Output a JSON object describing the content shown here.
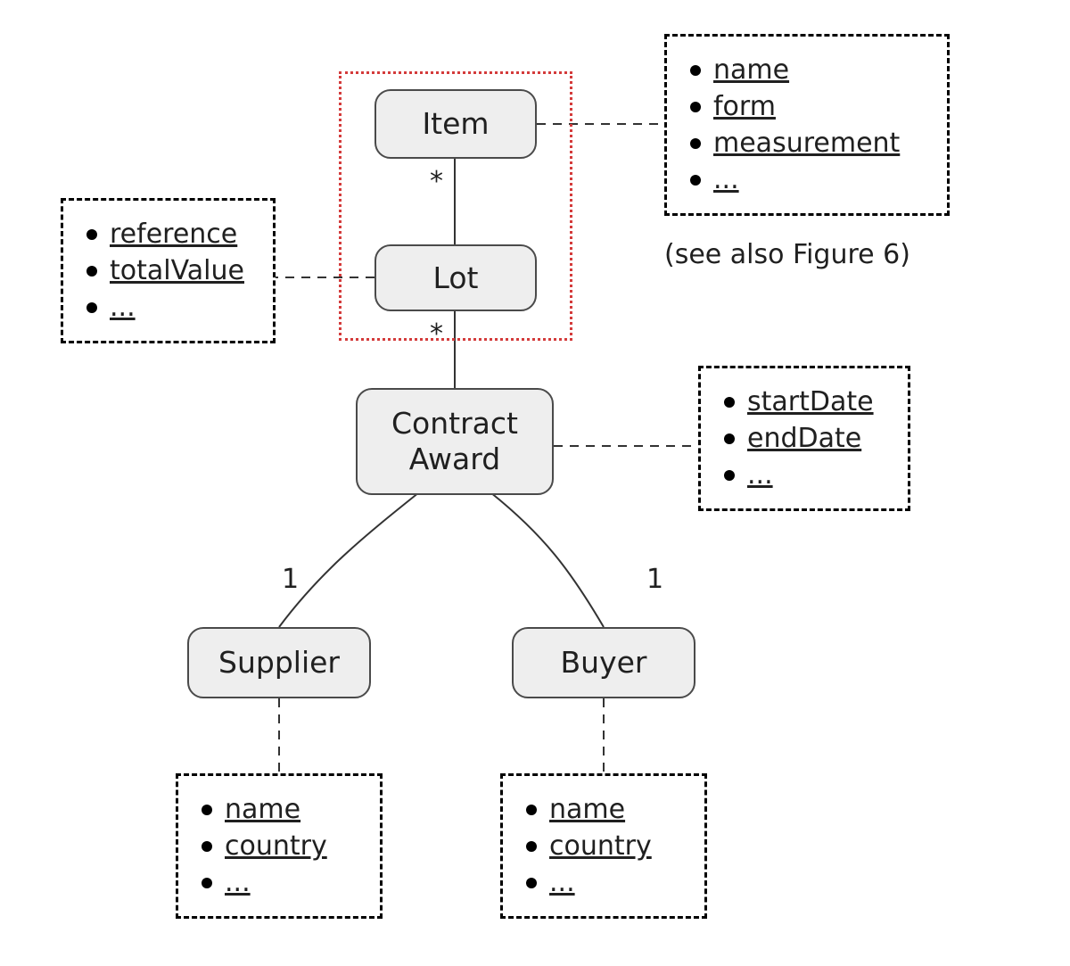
{
  "nodes": {
    "item": {
      "label": "Item"
    },
    "lot": {
      "label": "Lot"
    },
    "contractAward": {
      "label": "Contract\nAward"
    },
    "supplier": {
      "label": "Supplier"
    },
    "buyer": {
      "label": "Buyer"
    }
  },
  "attrs": {
    "item": {
      "items": [
        "name",
        "form",
        "measurement",
        "..."
      ]
    },
    "lot": {
      "items": [
        "reference",
        "totalValue",
        "..."
      ]
    },
    "contractAward": {
      "items": [
        "startDate",
        "endDate",
        "..."
      ]
    },
    "supplier": {
      "items": [
        "name",
        "country",
        "..."
      ]
    },
    "buyer": {
      "items": [
        "name",
        "country",
        "..."
      ]
    }
  },
  "multiplicities": {
    "item_lot": "*",
    "lot_ca": "*",
    "supplier": "1",
    "buyer": "1"
  },
  "caption": {
    "seeAlso": "(see also Figure 6)"
  },
  "colors": {
    "nodeFill": "#eeeeee",
    "nodeBorder": "#4a4a4a",
    "highlight": "#d43b3b"
  }
}
